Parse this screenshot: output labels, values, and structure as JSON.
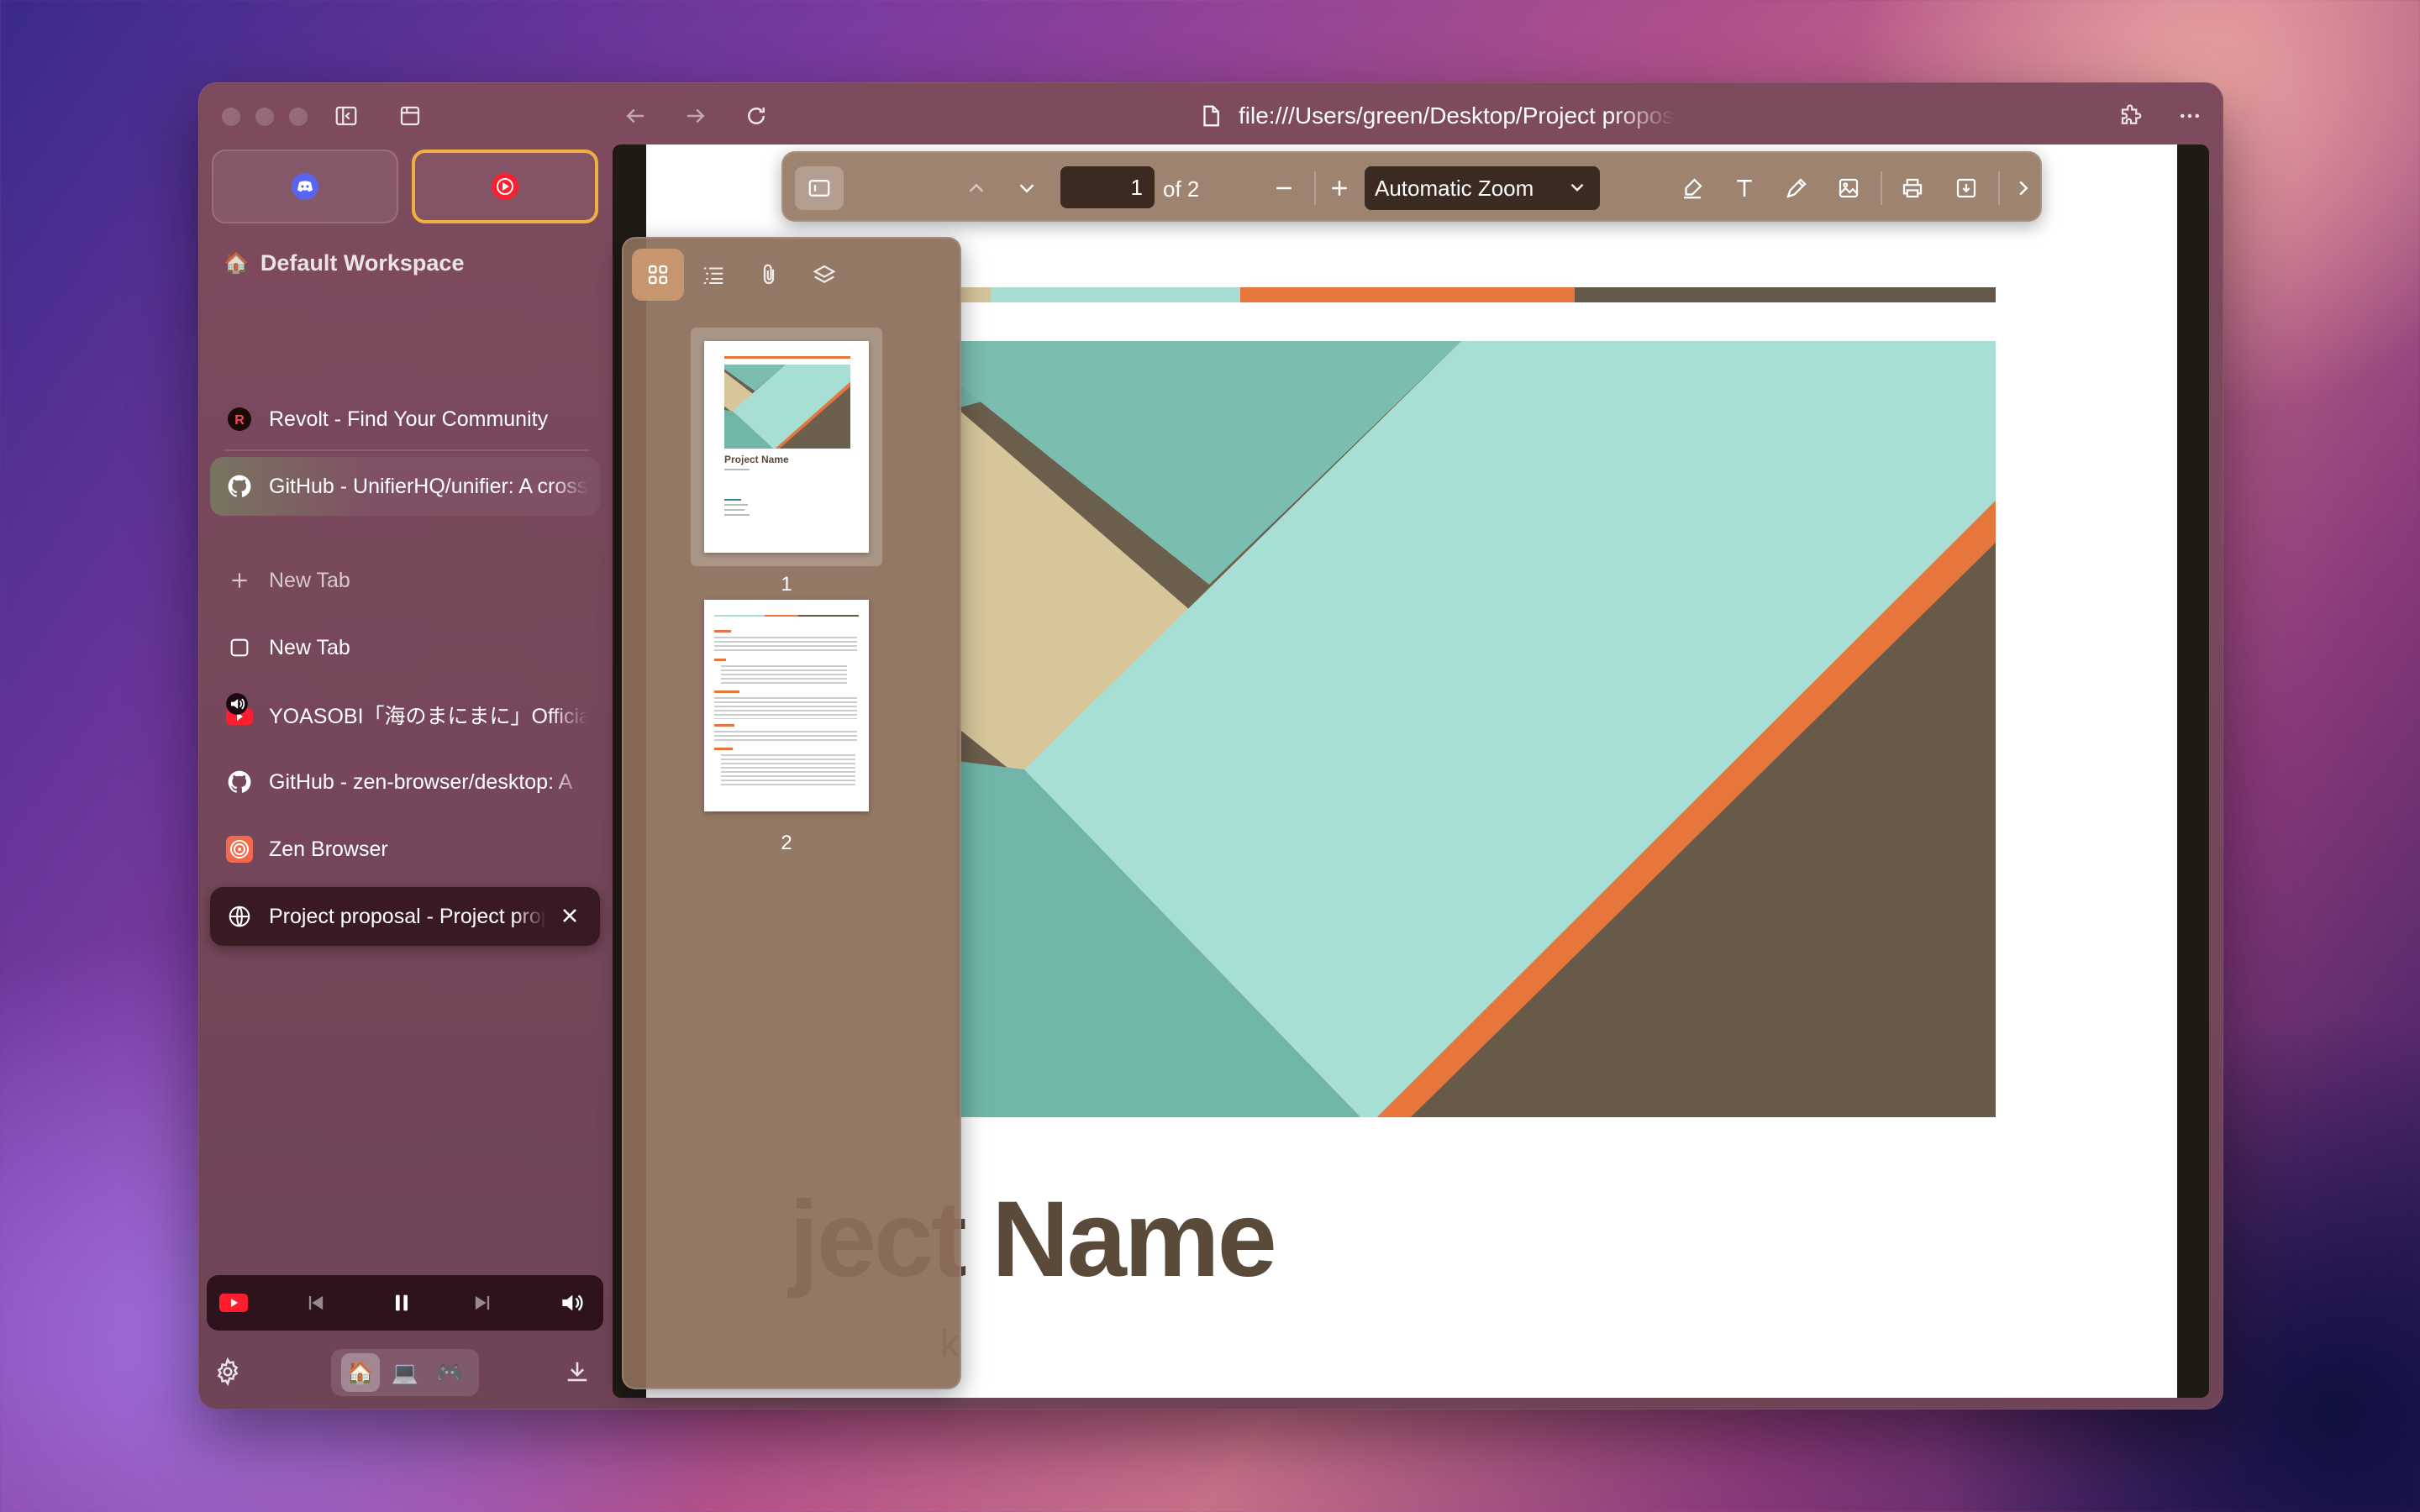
{
  "browser": {
    "url": "file:///Users/green/Desktop/Project proposal.pdf",
    "workspace": "Default Workspace",
    "workspace_icon": "🏠",
    "pinned_tabs": [
      {
        "label": "Revolt - Find Your Community",
        "icon": "revolt-icon"
      },
      {
        "label": "GitHub - UnifierHQ/unifier: A cross-platform bridge bot",
        "icon": "github-icon"
      }
    ],
    "new_tab_label": "New Tab",
    "tabs": [
      {
        "label": "New Tab",
        "icon": "blank-page-icon"
      },
      {
        "label": "YOASOBI「海のまにまに」Official Music Video",
        "icon": "youtube-icon"
      },
      {
        "label": "GitHub - zen-browser/desktop: A",
        "icon": "github-icon"
      },
      {
        "label": "Zen Browser",
        "icon": "zen-icon"
      },
      {
        "label": "Project proposal - Project proposal",
        "icon": "globe-icon"
      }
    ],
    "workspace_switcher": [
      "🏠",
      "💻",
      "🎮"
    ],
    "accent": "#f0b040"
  },
  "pdf": {
    "page_number": "1",
    "page_count": "of 2",
    "zoom": "Automatic Zoom",
    "thumbnails": [
      "1",
      "2"
    ],
    "thumb_title": "Project Name",
    "title_fragment": "ject Name",
    "subtitle_fragment": "k"
  }
}
